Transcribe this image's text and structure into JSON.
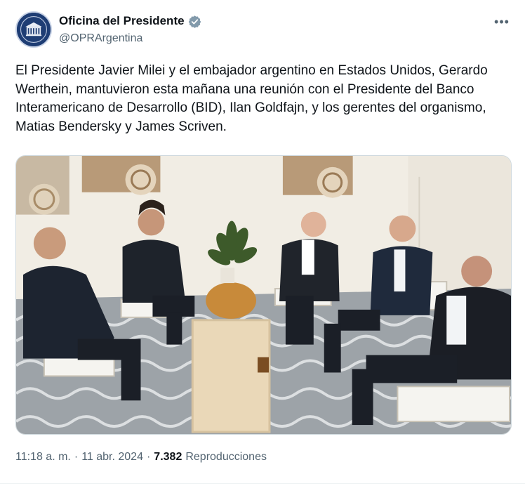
{
  "author": {
    "display_name": "Oficina del Presidente",
    "handle": "@OPRArgentina",
    "verified_badge_icon": "verified-badge-icon",
    "badge_color": "#829aab"
  },
  "actions": {
    "more_icon": "more-options-icon",
    "more_label": "•••"
  },
  "tweet": {
    "text": "El Presidente Javier Milei y el embajador argentino en Estados Unidos, Gerardo Werthein, mantuvieron esta mañana una reunión con el Presidente del Banco Interamericano de Desarrollo (BID), Ilan Goldfajn, y los gerentes del organismo, Matias Bendersky y James Scriven."
  },
  "media": {
    "type": "photo",
    "alt": ""
  },
  "meta": {
    "time": "11:18 a. m.",
    "separator": "·",
    "date": "11 abr. 2024",
    "views_count": "7.382",
    "views_label": "Reproducciones"
  },
  "colors": {
    "text_primary": "#0f1419",
    "text_secondary": "#536471",
    "border": "#cfd9de"
  }
}
